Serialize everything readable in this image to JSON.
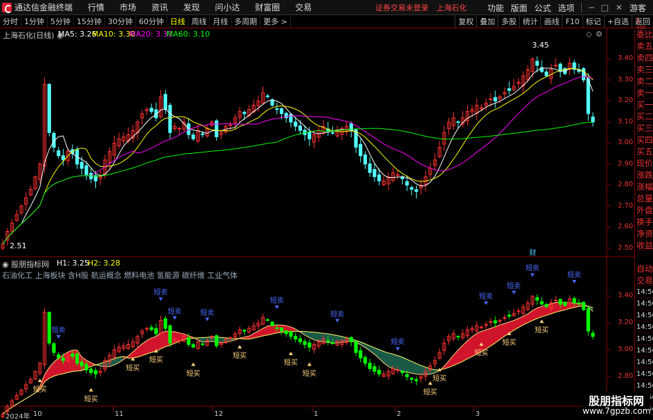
{
  "menubar": {
    "app_title": "通达信金融终端",
    "items": [
      "行情",
      "市场",
      "资讯",
      "发现",
      "问小达",
      "财富圈",
      "交易"
    ],
    "login_status": "证券交易未登录",
    "stock_name": "上海石化",
    "right_items": [
      "功能",
      "版面",
      "公式",
      "选项"
    ],
    "guest": "游客"
  },
  "toolbar": {
    "periods": [
      "分时",
      "1分钟",
      "5分钟",
      "15分钟",
      "30分钟",
      "60分钟",
      "日线",
      "周线",
      "月线",
      "多周期",
      "更多"
    ],
    "active_period": "日线",
    "right_buttons": [
      "复权",
      "叠加",
      "多股",
      "统计",
      "画线",
      "F10",
      "标记",
      "+自选",
      "返回"
    ]
  },
  "price_panel": {
    "title": "上海石化(日线)",
    "ma": [
      {
        "label": "MA5: 3.26",
        "color": "#ffffff"
      },
      {
        "label": "MA10: 3.30",
        "color": "#ffff00"
      },
      {
        "label": "MA20: 3.31",
        "color": "#ff00ff"
      },
      {
        "label": "MA60: 3.10",
        "color": "#00ff00"
      }
    ],
    "y_ticks": [
      "3.40",
      "3.30",
      "3.20",
      "3.10",
      "3.00",
      "2.90",
      "2.80",
      "2.70",
      "2.60",
      "2.50"
    ],
    "high_label": "3.45",
    "low_label": "2.51",
    "fin_marker": "财",
    "scale_unit": "L",
    "scale_num": "500"
  },
  "indicator_panel": {
    "title": "股朋指标网",
    "h1": "H1: 3.25",
    "h2": "H2: 3.28",
    "concepts": "石油化工 上海板块 含H股 航运概念 燃料电池 氢能源 碳纤维 工业气体",
    "y_ticks": [
      "3.40",
      "3.20",
      "3.00",
      "2.80"
    ],
    "sell_label": "短卖",
    "buy_label": "短买"
  },
  "x_axis": {
    "labels": [
      "2024年",
      "10",
      "11",
      "12",
      "1",
      "2",
      "3"
    ]
  },
  "sidebar": {
    "items": [
      "委比",
      "卖五",
      "卖四",
      "卖三",
      "卖二",
      "卖一",
      "买一",
      "买二",
      "买三",
      "买四",
      "买五",
      "现价",
      "涨跌",
      "涨幅",
      "总量",
      "外盘",
      "换手",
      "净资",
      "收益"
    ],
    "items2": [
      "自动",
      "交易"
    ],
    "times": [
      "14:56",
      "14:56",
      "14:56",
      "14:56",
      "14:56",
      "14:56",
      "14:56",
      "14:56",
      "14:56",
      "14:56",
      "14:56"
    ]
  },
  "watermark": {
    "line1": "股朋指标网",
    "line2": "www.7gpzb.com"
  },
  "chart_data": {
    "type": "candlestick",
    "title": "上海石化(日线)",
    "y_range": [
      2.48,
      3.5
    ],
    "closes": [
      2.52,
      2.58,
      2.62,
      2.66,
      2.7,
      2.74,
      2.78,
      2.84,
      2.9,
      3.28,
      3.05,
      2.98,
      2.94,
      2.92,
      2.96,
      2.95,
      2.9,
      2.88,
      2.85,
      2.83,
      2.82,
      2.84,
      2.92,
      2.96,
      3.0,
      3.02,
      3.03,
      3.04,
      3.06,
      3.1,
      3.14,
      3.16,
      3.15,
      3.12,
      3.22,
      3.16,
      3.05,
      3.08,
      3.07,
      3.1,
      3.04,
      3.02,
      3.06,
      3.04,
      3.07,
      3.1,
      3.03,
      3.05,
      3.08,
      3.09,
      3.12,
      3.15,
      3.14,
      3.16,
      3.18,
      3.2,
      3.24,
      3.22,
      3.18,
      3.16,
      3.14,
      3.12,
      3.1,
      3.08,
      3.06,
      3.04,
      3.02,
      3.04,
      3.06,
      3.08,
      3.06,
      3.05,
      3.06,
      3.07,
      3.08,
      3.06,
      2.98,
      2.94,
      2.9,
      2.86,
      2.84,
      2.82,
      2.82,
      2.84,
      2.86,
      2.85,
      2.83,
      2.8,
      2.78,
      2.77,
      2.8,
      2.84,
      2.88,
      2.92,
      2.98,
      3.05,
      3.1,
      3.12,
      3.1,
      3.12,
      3.15,
      3.16,
      3.18,
      3.17,
      3.19,
      3.21,
      3.2,
      3.22,
      3.24,
      3.25,
      3.27,
      3.29,
      3.32,
      3.35,
      3.4,
      3.37,
      3.34,
      3.32,
      3.35,
      3.37,
      3.34,
      3.33,
      3.38,
      3.35,
      3.34,
      3.3,
      3.14,
      3.1
    ]
  }
}
